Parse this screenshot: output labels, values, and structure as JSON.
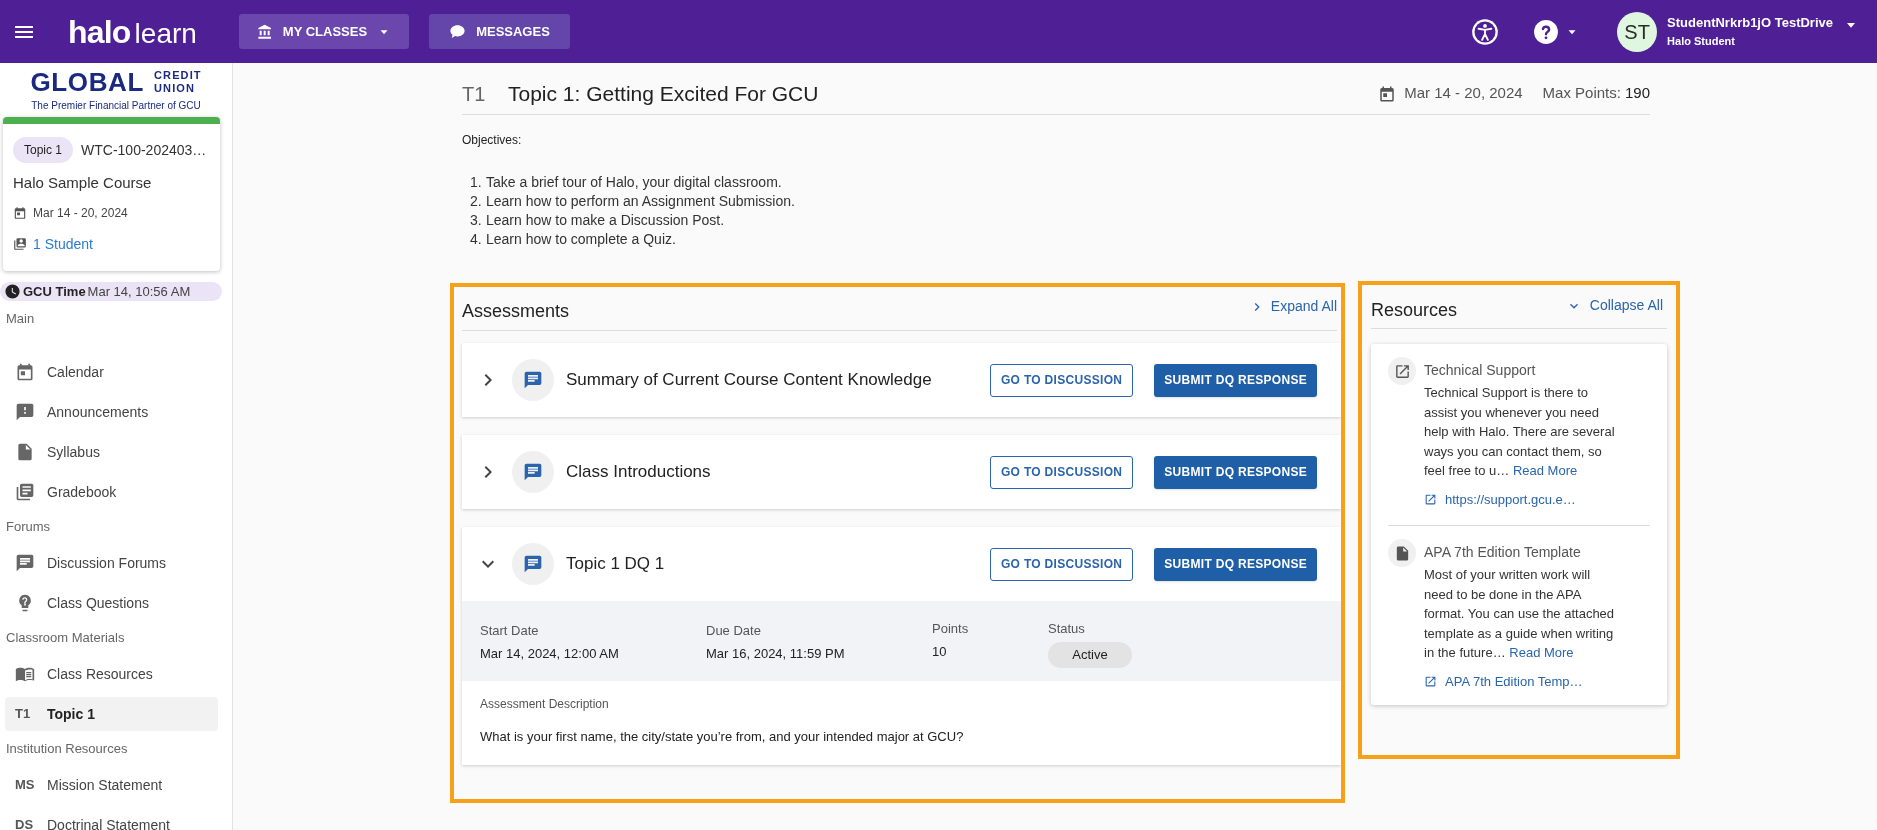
{
  "top_bar": {
    "brand_bold": "halo",
    "brand_light": "learn",
    "nav": [
      {
        "kind": "classes",
        "label": "MY CLASSES"
      },
      {
        "kind": "messages",
        "label": "MESSAGES"
      }
    ],
    "user": {
      "initials": "ST",
      "name": "StudentNrkrb1jO TestDrive",
      "role": "Halo Student"
    }
  },
  "sidebar": {
    "sponsor": {
      "word": "GLOBAL",
      "line_1": "CREDIT",
      "line_2": "UNION",
      "tagline": "The Premier Financial Partner of GCU"
    },
    "course_card": {
      "tag": "Topic 1",
      "code": "WTC-100-202403…",
      "name": "Halo Sample Course",
      "dates": "Mar 14 - 20, 2024",
      "students": "1 Student"
    },
    "clock": {
      "label": "GCU Time",
      "value": "Mar 14, 10:56 AM"
    },
    "sections": [
      {
        "title": "Main",
        "items": [
          {
            "kind": "calendar",
            "label": "Calendar",
            "selected": false
          },
          {
            "kind": "alert",
            "label": "Announcements",
            "selected": false
          },
          {
            "kind": "document",
            "label": "Syllabus",
            "selected": false
          },
          {
            "kind": "gradebook",
            "label": "Gradebook",
            "selected": false
          }
        ]
      },
      {
        "title": "Forums",
        "items": [
          {
            "kind": "chat",
            "label": "Discussion Forums",
            "selected": false
          },
          {
            "kind": "question",
            "label": "Class Questions",
            "selected": false
          }
        ]
      },
      {
        "title": "Classroom Materials",
        "items": [
          {
            "kind": "book",
            "label": "Class Resources",
            "selected": false
          },
          {
            "kind": "abbr",
            "abbr": "T1",
            "label": "Topic 1",
            "selected": true
          }
        ]
      },
      {
        "title": "Institution Resources",
        "items": [
          {
            "kind": "abbr",
            "abbr": "MS",
            "label": "Mission Statement",
            "selected": false
          },
          {
            "kind": "abbr",
            "abbr": "DS",
            "label": "Doctrinal Statement",
            "selected": false
          }
        ]
      }
    ]
  },
  "topic": {
    "abbr": "T1",
    "title": "Topic 1: Getting Excited For GCU",
    "dates": "Mar 14 - 20, 2024",
    "max_points_label": "Max Points:",
    "max_points": "190",
    "objectives_label": "Objectives:",
    "objectives": [
      {
        "number": "1.",
        "text": "Take a brief tour of Halo, your digital classroom."
      },
      {
        "number": "2.",
        "text": "Learn how to perform an Assignment Submission."
      },
      {
        "number": "3.",
        "text": "Learn how to make a Discussion Post."
      },
      {
        "number": "4.",
        "text": "Learn how to complete a Quiz."
      }
    ]
  },
  "assessments": {
    "title": "Assessments",
    "toggle": "Expand All",
    "items": [
      {
        "title": "Summary of Current Course Content Knowledge",
        "expanded": false,
        "buttons": [
          "GO TO DISCUSSION",
          "SUBMIT DQ RESPONSE"
        ]
      },
      {
        "title": "Class Introductions",
        "expanded": false,
        "buttons": [
          "GO TO DISCUSSION",
          "SUBMIT DQ RESPONSE"
        ]
      },
      {
        "title": "Topic 1 DQ 1",
        "expanded": true,
        "buttons": [
          "GO TO DISCUSSION",
          "SUBMIT DQ RESPONSE"
        ],
        "details": {
          "fields": [
            {
              "label": "Start Date",
              "value": "Mar 14, 2024, 12:00 AM"
            },
            {
              "label": "Due Date",
              "value": "Mar 16, 2024, 11:59 PM"
            },
            {
              "label": "Points",
              "value": "10"
            }
          ],
          "status_label": "Status",
          "status": "Active",
          "description_label": "Assessment Description",
          "description": "What is your first name, the city/state you’re from, and your intended major at GCU?"
        }
      }
    ]
  },
  "resources": {
    "title": "Resources",
    "toggle": "Collapse All",
    "items": [
      {
        "kind": "link",
        "title": "Technical Support",
        "summary": "Technical Support is there to assist you whenever you need help with Halo. There are several ways you can contact them, so feel free to u…",
        "read_more": "Read More",
        "link": "https://support.gcu.e…"
      },
      {
        "kind": "file",
        "title": "APA 7th Edition Template",
        "summary": "Most of your written work will need to be done in the APA format. You can use the attached template as a guide when writing in the future…",
        "read_more": "Read More",
        "link": "APA 7th Edition Temp…"
      }
    ]
  }
}
